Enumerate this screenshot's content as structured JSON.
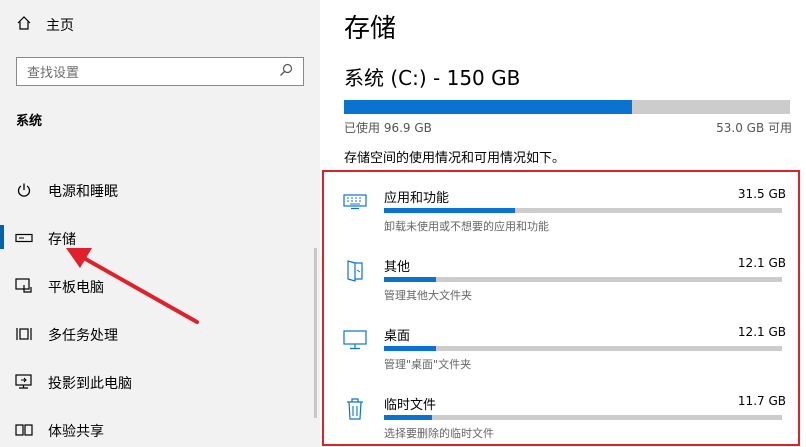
{
  "sidebar": {
    "home_label": "主页",
    "search_placeholder": "查找设置",
    "section_title": "系统",
    "items": [
      {
        "label": "电源和睡眠",
        "icon": "power-icon"
      },
      {
        "label": "存储",
        "icon": "storage-icon",
        "selected": true
      },
      {
        "label": "平板电脑",
        "icon": "tablet-icon"
      },
      {
        "label": "多任务处理",
        "icon": "multitask-icon"
      },
      {
        "label": "投影到此电脑",
        "icon": "project-icon"
      },
      {
        "label": "体验共享",
        "icon": "share-icon"
      }
    ]
  },
  "main": {
    "title": "存储",
    "drive_title": "系统 (C:) - 150 GB",
    "used_label": "已使用 96.9 GB",
    "available_label": "53.0 GB 可用",
    "used_fraction": 0.646,
    "description": "存储空间的使用情况和可用情况如下。",
    "categories": [
      {
        "name": "应用和功能",
        "size": "31.5 GB",
        "subtitle": "卸载未使用或不想要的应用和功能",
        "fraction": 0.33,
        "icon": "keyboard-icon"
      },
      {
        "name": "其他",
        "size": "12.1 GB",
        "subtitle": "管理其他大文件夹",
        "fraction": 0.13,
        "icon": "folder-icon"
      },
      {
        "name": "桌面",
        "size": "12.1 GB",
        "subtitle": "管理\"桌面\"文件夹",
        "fraction": 0.13,
        "icon": "monitor-icon"
      },
      {
        "name": "临时文件",
        "size": "11.7 GB",
        "subtitle": "选择要删除的临时文件",
        "fraction": 0.12,
        "icon": "trash-icon"
      }
    ]
  },
  "colors": {
    "accent": "#0a73d0",
    "highlight": "#e0202a"
  }
}
